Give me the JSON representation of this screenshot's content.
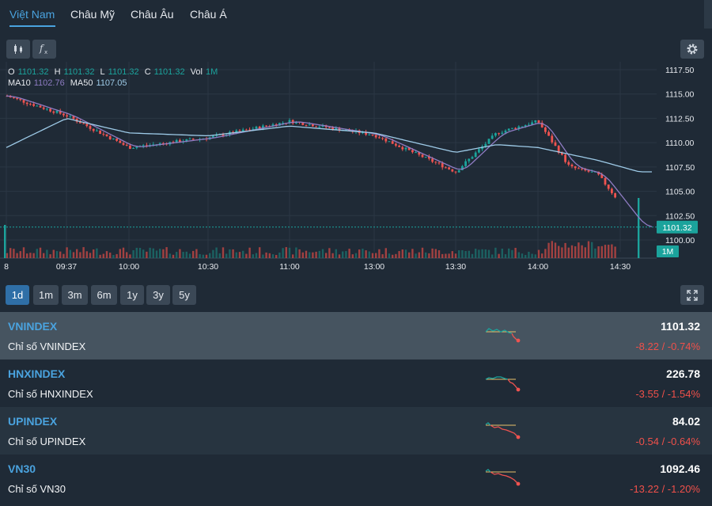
{
  "tabs": [
    {
      "label": "Việt Nam",
      "active": true
    },
    {
      "label": "Châu Mỹ",
      "active": false
    },
    {
      "label": "Châu Âu",
      "active": false
    },
    {
      "label": "Châu Á",
      "active": false
    }
  ],
  "toolbar": {
    "indicator_icon": "fx-icon",
    "candle_icon": "candlestick-icon",
    "settings_icon": "gear-icon"
  },
  "legend": {
    "o_label": "O",
    "o_value": "1101.32",
    "h_label": "H",
    "h_value": "1101.32",
    "l_label": "L",
    "l_value": "1101.32",
    "c_label": "C",
    "c_value": "1101.32",
    "vol_label": "Vol",
    "vol_value": "1M",
    "ma10_label": "MA10",
    "ma10_value": "1102.76",
    "ma50_label": "MA50",
    "ma50_value": "1107.05"
  },
  "chart": {
    "price_ticks": [
      "1117.50",
      "1115.00",
      "1112.50",
      "1110.00",
      "1107.50",
      "1105.00",
      "1102.50",
      "1100.00"
    ],
    "time_ticks": [
      "8",
      "09:37",
      "10:00",
      "10:30",
      "11:00",
      "13:00",
      "13:30",
      "14:00",
      "14:30"
    ],
    "last_price_label": "1101.32",
    "last_volume_label": "1M"
  },
  "chart_data": {
    "type": "line",
    "ylim": [
      1100,
      1117.5
    ],
    "x": [
      "09:15",
      "09:37",
      "10:00",
      "10:30",
      "11:00",
      "13:00",
      "13:30",
      "13:45",
      "14:00",
      "14:10",
      "14:20",
      "14:30"
    ],
    "series": [
      {
        "values": [
          1114.8,
          1112.8,
          1109.5,
          1110.5,
          1112.2,
          1110.8,
          1107.0,
          1111.0,
          1112.2,
          1107.5,
          1106.8,
          1101.32
        ]
      },
      {
        "values": [
          1109.5,
          1112.5,
          1111.0,
          1110.7,
          1111.7,
          1111.0,
          1109.0,
          1109.8,
          1109.5,
          1108.8,
          1108.2,
          1107.0
        ]
      }
    ],
    "grid": true
  },
  "ranges": [
    {
      "label": "1d",
      "active": true
    },
    {
      "label": "1m",
      "active": false
    },
    {
      "label": "3m",
      "active": false
    },
    {
      "label": "6m",
      "active": false
    },
    {
      "label": "1y",
      "active": false
    },
    {
      "label": "3y",
      "active": false
    },
    {
      "label": "5y",
      "active": false
    }
  ],
  "indices": [
    {
      "code": "VNINDEX",
      "name": "Chỉ số VNINDEX",
      "value": "1101.32",
      "change": "-8.22 / -0.74%"
    },
    {
      "code": "HNXINDEX",
      "name": "Chỉ số HNXINDEX",
      "value": "226.78",
      "change": "-3.55 / -1.54%"
    },
    {
      "code": "UPINDEX",
      "name": "Chỉ số UPINDEX",
      "value": "84.02",
      "change": "-0.54 / -0.64%"
    },
    {
      "code": "VN30",
      "name": "Chỉ số VN30",
      "value": "1092.46",
      "change": "-13.22 / -1.20%"
    }
  ],
  "colors": {
    "up": "#1ba39c",
    "down": "#ef5350",
    "accent": "#4aa3df",
    "ma10": "#8e7cc3",
    "ma50": "#9ecbe8"
  }
}
